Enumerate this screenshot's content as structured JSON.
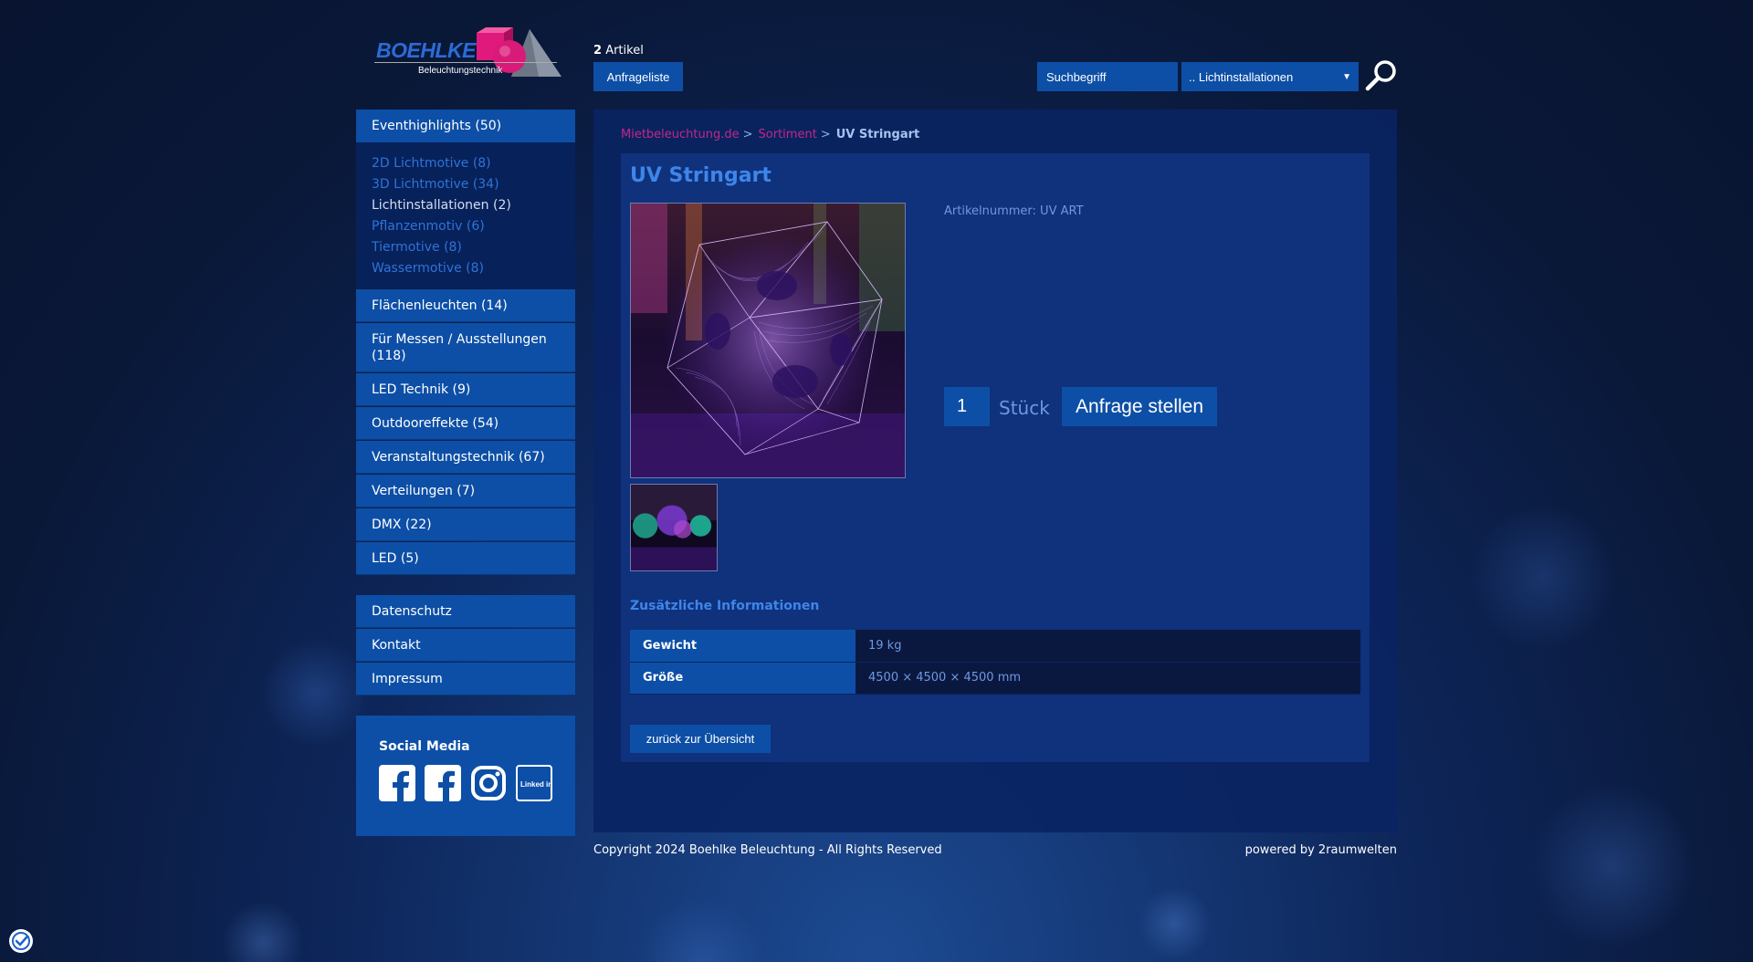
{
  "header": {
    "logo_text": "BOEHLKE",
    "logo_sub": "Beleuchtungstechnik",
    "cart_count": "2",
    "cart_label": "Artikel",
    "anfrageliste_label": "Anfrageliste",
    "search_placeholder": "Suchbegriff",
    "category_select_value": ".. Lichtinstallationen"
  },
  "sidebar": {
    "main_category": "Eventhighlights (50)",
    "subcategories": [
      {
        "label": "2D Lichtmotive (8)",
        "active": false
      },
      {
        "label": "3D Lichtmotive (34)",
        "active": false
      },
      {
        "label": "Lichtinstallationen (2)",
        "active": true
      },
      {
        "label": "Pflanzenmotiv (6)",
        "active": false
      },
      {
        "label": "Tiermotive (8)",
        "active": false
      },
      {
        "label": "Wassermotive (8)",
        "active": false
      }
    ],
    "categories": [
      "Flächenleuchten (14)",
      "Für Messen / Ausstellungen (118)",
      "LED Technik (9)",
      "Outdooreffekte (54)",
      "Veranstaltungstechnik (67)",
      "Verteilungen (7)",
      "DMX (22)",
      "LED (5)"
    ],
    "legal": [
      "Datenschutz",
      "Kontakt",
      "Impressum"
    ],
    "social_title": "Social Media",
    "social_icons": [
      "facebook-icon",
      "facebook-icon",
      "instagram-icon",
      "linkedin-icon"
    ],
    "linkedin_text": "Linked in"
  },
  "breadcrumb": {
    "home": "Mietbeleuchtung.de",
    "sep1": ">",
    "sortiment": "Sortiment",
    "sep2": ">",
    "current": "UV Stringart"
  },
  "product": {
    "title": "UV Stringart",
    "artikelnummer": "Artikelnummer: UV ART",
    "quantity": "1",
    "unit": "Stück",
    "request_button": "Anfrage stellen",
    "info_title": "Zusätzliche Informationen",
    "info_rows": [
      {
        "label": "Gewicht",
        "value": "19 kg"
      },
      {
        "label": "Größe",
        "value": "4500 × 4500 × 4500 mm"
      }
    ],
    "back_button": "zurück zur Übersicht"
  },
  "footer": {
    "copyright": "Copyright 2024 Boehlke Beleuchtung - All Rights Reserved",
    "powered": "powered by 2raumwelten"
  },
  "colors": {
    "accent_blue": "#0d4fa6",
    "title_blue": "#3d86ea",
    "link_magenta": "#c4268a"
  }
}
